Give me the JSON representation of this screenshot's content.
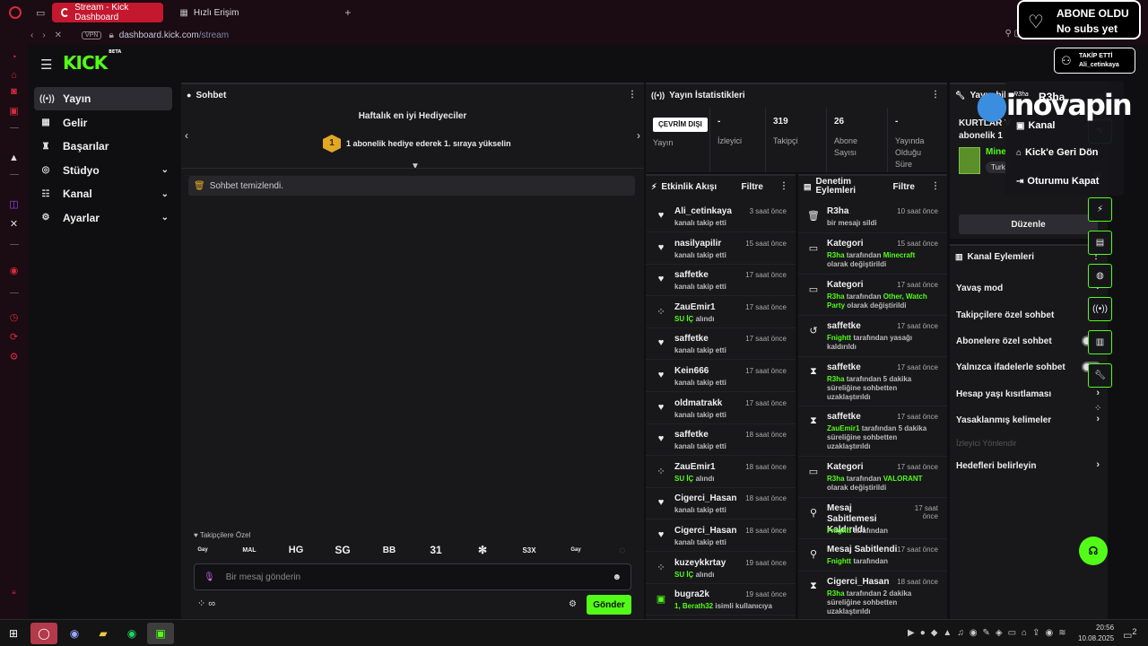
{
  "browser": {
    "tabs": [
      {
        "label": "Stream - Kick Dashboard"
      },
      {
        "label": "Hızlı Erişim"
      }
    ],
    "new_tab": "+",
    "vpn": "VPN",
    "url_domain": "dashboard.kick.com",
    "url_path": "/stream"
  },
  "brand": {
    "logo": "KICK",
    "beta": "BETA"
  },
  "nav": {
    "items": [
      {
        "label": "Yayın",
        "icon": "broadcast-icon"
      },
      {
        "label": "Gelir",
        "icon": "revenue-icon"
      },
      {
        "label": "Başarılar",
        "icon": "trophy-icon"
      },
      {
        "label": "Stüdyo",
        "icon": "studio-icon"
      },
      {
        "label": "Kanal",
        "icon": "channel-icon"
      },
      {
        "label": "Ayarlar",
        "icon": "gear-icon"
      }
    ]
  },
  "chat": {
    "title": "Sohbet",
    "gift_title": "Haftalık en iyi Hediyeciler",
    "gift_badge": "1",
    "gift_text": "1 abonelik hediye ederek 1. sıraya yükselin",
    "cleared": "Sohbet temizlendi.",
    "followers_only": "Takipçilere Özel",
    "emotes": [
      "Gay",
      "MAL",
      "HG",
      "SG",
      "BB",
      "31",
      "✻",
      "S3X",
      "Gay",
      "◌"
    ],
    "placeholder": "Bir mesaj gönderin",
    "infinity": "∞",
    "send": "Gönder"
  },
  "stats": {
    "title": "Yayın İstatistikleri",
    "offline_badge": "ÇEVRİM DIŞI",
    "items": [
      {
        "value": "",
        "label": "Yayın"
      },
      {
        "value": "-",
        "label": "İzleyici"
      },
      {
        "value": "319",
        "label": "Takipçi"
      },
      {
        "value": "26",
        "label": "Abone Sayısı"
      },
      {
        "value": "-",
        "label": "Yayında Olduğu Süre"
      }
    ]
  },
  "activity": {
    "title": "Etkinlik Akışı",
    "filter": "Filtre",
    "items": [
      {
        "user": "Ali_cetinkaya",
        "time": "3 saat önce",
        "pre": "",
        "green": "",
        "rest": "kanalı takip etti"
      },
      {
        "user": "nasilyapilir",
        "time": "15 saat önce",
        "pre": "",
        "green": "",
        "rest": "kanalı takip etti"
      },
      {
        "user": "saffetke",
        "time": "17 saat önce",
        "pre": "",
        "green": "",
        "rest": "kanalı takip etti"
      },
      {
        "user": "ZauEmir1",
        "time": "17 saat önce",
        "pre": "",
        "green": "SU İÇ",
        "rest": " alındı"
      },
      {
        "user": "saffetke",
        "time": "17 saat önce",
        "pre": "",
        "green": "",
        "rest": "kanalı takip etti"
      },
      {
        "user": "Kein666",
        "time": "17 saat önce",
        "pre": "",
        "green": "",
        "rest": "kanalı takip etti"
      },
      {
        "user": "oldmatrakk",
        "time": "17 saat önce",
        "pre": "",
        "green": "",
        "rest": "kanalı takip etti"
      },
      {
        "user": "saffetke",
        "time": "18 saat önce",
        "pre": "",
        "green": "",
        "rest": "kanalı takip etti"
      },
      {
        "user": "ZauEmir1",
        "time": "18 saat önce",
        "pre": "",
        "green": "SU İÇ",
        "rest": " alındı"
      },
      {
        "user": "Cigerci_Hasan",
        "time": "18 saat önce",
        "pre": "",
        "green": "",
        "rest": "kanalı takip etti"
      },
      {
        "user": "Cigerci_Hasan",
        "time": "18 saat önce",
        "pre": "",
        "green": "",
        "rest": "kanalı takip etti"
      },
      {
        "user": "kuzeykkrtay",
        "time": "19 saat önce",
        "pre": "",
        "green": "SU İÇ",
        "rest": " alındı"
      },
      {
        "user": "bugra2k",
        "time": "19 saat önce",
        "pre": "",
        "green": "1, Berath32",
        "rest": " isimli kullanıcıya"
      }
    ]
  },
  "moderation": {
    "title": "Denetim Eylemleri",
    "filter": "Filtre",
    "items": [
      {
        "title": "R3ha",
        "time": "10 saat önce",
        "g1": "",
        "t1": "bir mesajı sildi",
        "g2": "",
        "t2": ""
      },
      {
        "title": "Kategori",
        "time": "15 saat önce",
        "g1": "R3ha",
        "t1": " tarafından ",
        "g2": "Minecraft",
        "t2": " olarak değiştirildi"
      },
      {
        "title": "Kategori",
        "time": "17 saat önce",
        "g1": "R3ha",
        "t1": " tarafından ",
        "g2": "Other, Watch Party",
        "t2": " olarak değiştirildi"
      },
      {
        "title": "saffetke",
        "time": "17 saat önce",
        "g1": "Fnightt",
        "t1": " tarafından yasağı kaldırıldı",
        "g2": "",
        "t2": ""
      },
      {
        "title": "saffetke",
        "time": "17 saat önce",
        "g1": "R3ha",
        "t1": " tarafından 5 dakika süreliğine sohbetten uzaklaştırıldı",
        "g2": "",
        "t2": ""
      },
      {
        "title": "saffetke",
        "time": "17 saat önce",
        "g1": "ZauEmir1",
        "t1": " tarafından 5 dakika süreliğine sohbetten uzaklaştırıldı",
        "g2": "",
        "t2": ""
      },
      {
        "title": "Kategori",
        "time": "17 saat önce",
        "g1": "R3ha",
        "t1": " tarafından ",
        "g2": "VALORANT",
        "t2": " olarak değiştirildi"
      },
      {
        "title": "Mesaj Sabitlemesi Kaldırıldı",
        "time": "17 saat önce",
        "g1": "Fnightt",
        "t1": " tarafından",
        "g2": "",
        "t2": ""
      },
      {
        "title": "Mesaj Sabitlendi",
        "time": "17 saat önce",
        "g1": "Fnightt",
        "t1": " tarafından",
        "g2": "",
        "t2": ""
      },
      {
        "title": "Cigerci_Hasan",
        "time": "18 saat önce",
        "g1": "R3ha",
        "t1": " tarafından 2 dakika süreliğine sohbetten uzaklaştırıldı",
        "g2": "",
        "t2": ""
      }
    ]
  },
  "stream_info": {
    "title": "Yayın bilg",
    "line1": "KURTLAR V",
    "line2": "abonelik 1",
    "game": "Mine",
    "tag": "Turk",
    "edit": "Düzenle"
  },
  "channel_actions": {
    "title": "Kanal Eylemleri",
    "items": [
      {
        "label": "Yavaş mod",
        "kind": "arrow"
      },
      {
        "label": "Takipçilere özel sohbet",
        "kind": "arrow"
      },
      {
        "label": "Abonelere özel sohbet",
        "kind": "toggle"
      },
      {
        "label": "Yalnızca ifadelerle sohbet",
        "kind": "toggle"
      },
      {
        "label": "Hesap yaşı kısıtlaması",
        "kind": "arrow"
      },
      {
        "label": "Yasaklanmış kelimeler",
        "kind": "arrow"
      },
      {
        "label": "İzleyici Yönlendir",
        "kind": "disabled"
      },
      {
        "label": "Hedefleri belirleyin",
        "kind": "arrow"
      }
    ]
  },
  "overlays": {
    "sub_title": "ABONE OLDU",
    "sub_sub": "No subs yet",
    "follow_title": "TAKİP ETTİ",
    "follow_user": "Ali_cetinkaya",
    "watermark": "inovapin",
    "r3ha_small": "R3ha",
    "r3ha_big": "R3ha"
  },
  "user_menu": {
    "items": [
      {
        "label": "Kanal",
        "icon": "channel-icon"
      },
      {
        "label": "Kick'e Geri Dön",
        "icon": "home-icon"
      },
      {
        "label": "Oturumu Kapat",
        "icon": "logout-icon"
      }
    ]
  },
  "taskbar": {
    "time": "20:56",
    "date": "10.08.2025",
    "badge": "2"
  }
}
